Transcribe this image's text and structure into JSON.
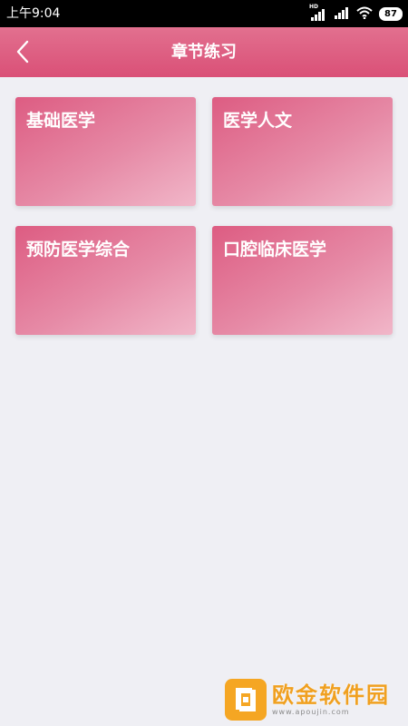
{
  "status_bar": {
    "time": "上午9:04",
    "network_tag": "HD",
    "battery": "87"
  },
  "header": {
    "title": "章节练习"
  },
  "cards": [
    {
      "label": "基础医学"
    },
    {
      "label": "医学人文"
    },
    {
      "label": "预防医学综合"
    },
    {
      "label": "口腔临床医学"
    }
  ],
  "watermark": {
    "title": "欧金软件园",
    "url": "www.apoujin.com"
  },
  "colors": {
    "accent": "#da5077",
    "background": "#efeff4",
    "status_bar": "#000000"
  },
  "icons": {
    "back": "chevron-left-icon",
    "signal": "signal-icon",
    "wifi": "wifi-icon",
    "battery": "battery-icon"
  }
}
